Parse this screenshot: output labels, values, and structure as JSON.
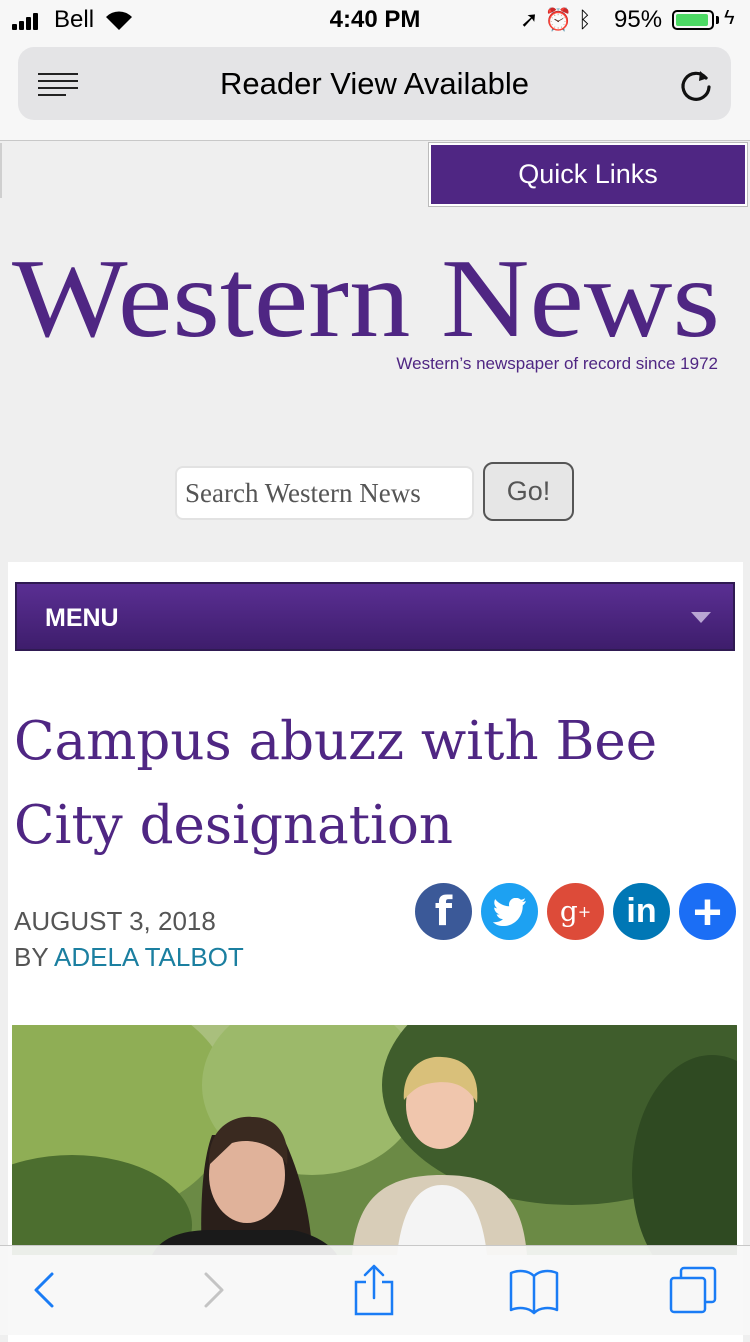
{
  "status": {
    "carrier": "Bell",
    "time": "4:40 PM",
    "battery_pct": "95%",
    "battery_level": 0.95,
    "icons": [
      "location-icon",
      "alarm-icon",
      "bluetooth-icon",
      "wifi-icon",
      "charging-icon"
    ]
  },
  "address_bar": {
    "title": "Reader View Available"
  },
  "page": {
    "quick_links": "Quick Links",
    "logo_text": "Western News",
    "tagline": "Western’s newspaper of record since 1972",
    "search_placeholder": "Search Western News",
    "go_label": "Go!",
    "menu_label": "MENU",
    "headline": "Campus abuzz with Bee City designation",
    "date": "AUGUST 3, 2018",
    "by_label": "BY",
    "author": "ADELA TALBOT",
    "share_icons": [
      "facebook-icon",
      "twitter-icon",
      "google-plus-icon",
      "linkedin-icon",
      "add-icon"
    ]
  },
  "colors": {
    "brand_purple": "#4f2683",
    "link_blue": "#1b7fa0",
    "ios_blue": "#1a7cf5"
  }
}
